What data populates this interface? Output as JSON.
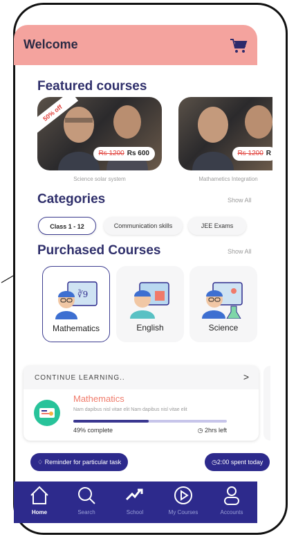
{
  "header": {
    "title": "Welcome",
    "cart_icon": "cart-icon"
  },
  "featured": {
    "heading": "Featured courses",
    "items": [
      {
        "badge": "50% off",
        "old_price": "Rs 1200",
        "new_price": "Rs 600",
        "label": "Science solar system"
      },
      {
        "old_price": "Rs 1200",
        "new_price": "R",
        "label": "Mathametics Integration"
      }
    ]
  },
  "categories": {
    "heading": "Categories",
    "show_all": "Show All",
    "chips": [
      "Class 1 - 12",
      "Communication skills",
      "JEE Exams"
    ]
  },
  "purchased": {
    "heading": "Purchased Courses",
    "show_all": "Show All",
    "items": [
      "Mathematics",
      "English",
      "Science"
    ]
  },
  "continue": {
    "title": "CONTINUE LEARNING..",
    "subject": "Mathematics",
    "description": "Nam dapibus nisl vitae elit Nam dapibus nisl vitae elit",
    "progress_text": "49% complete",
    "progress": 0.49,
    "time_left": "2hrs left"
  },
  "reminder": {
    "label": "Reminder for particular task"
  },
  "time_spent": {
    "label": "2:00 spent today"
  },
  "nav": [
    "Home",
    "Search",
    "School",
    "My Courses",
    "Accounts"
  ],
  "colors": {
    "accent": "#2d2a8c",
    "header": "#f4a39e",
    "subject": "#f07a6a"
  }
}
